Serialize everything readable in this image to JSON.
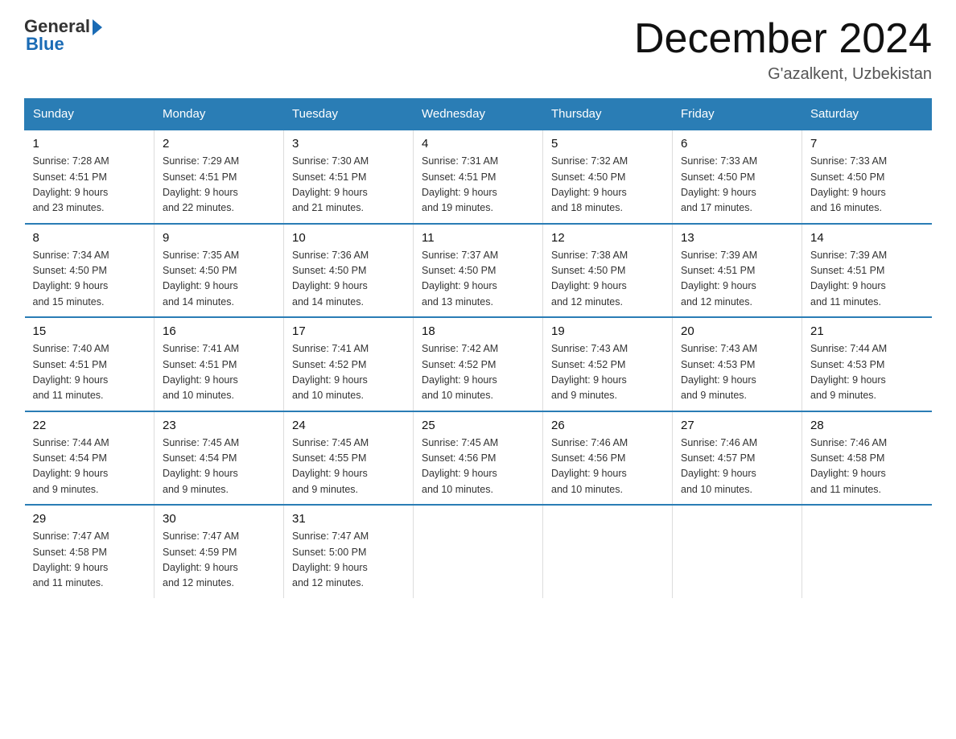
{
  "header": {
    "logo_general": "General",
    "logo_blue": "Blue",
    "title": "December 2024",
    "subtitle": "G'azalkent, Uzbekistan"
  },
  "days_of_week": [
    "Sunday",
    "Monday",
    "Tuesday",
    "Wednesday",
    "Thursday",
    "Friday",
    "Saturday"
  ],
  "weeks": [
    [
      {
        "day": "1",
        "sunrise": "7:28 AM",
        "sunset": "4:51 PM",
        "daylight": "9 hours and 23 minutes."
      },
      {
        "day": "2",
        "sunrise": "7:29 AM",
        "sunset": "4:51 PM",
        "daylight": "9 hours and 22 minutes."
      },
      {
        "day": "3",
        "sunrise": "7:30 AM",
        "sunset": "4:51 PM",
        "daylight": "9 hours and 21 minutes."
      },
      {
        "day": "4",
        "sunrise": "7:31 AM",
        "sunset": "4:51 PM",
        "daylight": "9 hours and 19 minutes."
      },
      {
        "day": "5",
        "sunrise": "7:32 AM",
        "sunset": "4:50 PM",
        "daylight": "9 hours and 18 minutes."
      },
      {
        "day": "6",
        "sunrise": "7:33 AM",
        "sunset": "4:50 PM",
        "daylight": "9 hours and 17 minutes."
      },
      {
        "day": "7",
        "sunrise": "7:33 AM",
        "sunset": "4:50 PM",
        "daylight": "9 hours and 16 minutes."
      }
    ],
    [
      {
        "day": "8",
        "sunrise": "7:34 AM",
        "sunset": "4:50 PM",
        "daylight": "9 hours and 15 minutes."
      },
      {
        "day": "9",
        "sunrise": "7:35 AM",
        "sunset": "4:50 PM",
        "daylight": "9 hours and 14 minutes."
      },
      {
        "day": "10",
        "sunrise": "7:36 AM",
        "sunset": "4:50 PM",
        "daylight": "9 hours and 14 minutes."
      },
      {
        "day": "11",
        "sunrise": "7:37 AM",
        "sunset": "4:50 PM",
        "daylight": "9 hours and 13 minutes."
      },
      {
        "day": "12",
        "sunrise": "7:38 AM",
        "sunset": "4:50 PM",
        "daylight": "9 hours and 12 minutes."
      },
      {
        "day": "13",
        "sunrise": "7:39 AM",
        "sunset": "4:51 PM",
        "daylight": "9 hours and 12 minutes."
      },
      {
        "day": "14",
        "sunrise": "7:39 AM",
        "sunset": "4:51 PM",
        "daylight": "9 hours and 11 minutes."
      }
    ],
    [
      {
        "day": "15",
        "sunrise": "7:40 AM",
        "sunset": "4:51 PM",
        "daylight": "9 hours and 11 minutes."
      },
      {
        "day": "16",
        "sunrise": "7:41 AM",
        "sunset": "4:51 PM",
        "daylight": "9 hours and 10 minutes."
      },
      {
        "day": "17",
        "sunrise": "7:41 AM",
        "sunset": "4:52 PM",
        "daylight": "9 hours and 10 minutes."
      },
      {
        "day": "18",
        "sunrise": "7:42 AM",
        "sunset": "4:52 PM",
        "daylight": "9 hours and 10 minutes."
      },
      {
        "day": "19",
        "sunrise": "7:43 AM",
        "sunset": "4:52 PM",
        "daylight": "9 hours and 9 minutes."
      },
      {
        "day": "20",
        "sunrise": "7:43 AM",
        "sunset": "4:53 PM",
        "daylight": "9 hours and 9 minutes."
      },
      {
        "day": "21",
        "sunrise": "7:44 AM",
        "sunset": "4:53 PM",
        "daylight": "9 hours and 9 minutes."
      }
    ],
    [
      {
        "day": "22",
        "sunrise": "7:44 AM",
        "sunset": "4:54 PM",
        "daylight": "9 hours and 9 minutes."
      },
      {
        "day": "23",
        "sunrise": "7:45 AM",
        "sunset": "4:54 PM",
        "daylight": "9 hours and 9 minutes."
      },
      {
        "day": "24",
        "sunrise": "7:45 AM",
        "sunset": "4:55 PM",
        "daylight": "9 hours and 9 minutes."
      },
      {
        "day": "25",
        "sunrise": "7:45 AM",
        "sunset": "4:56 PM",
        "daylight": "9 hours and 10 minutes."
      },
      {
        "day": "26",
        "sunrise": "7:46 AM",
        "sunset": "4:56 PM",
        "daylight": "9 hours and 10 minutes."
      },
      {
        "day": "27",
        "sunrise": "7:46 AM",
        "sunset": "4:57 PM",
        "daylight": "9 hours and 10 minutes."
      },
      {
        "day": "28",
        "sunrise": "7:46 AM",
        "sunset": "4:58 PM",
        "daylight": "9 hours and 11 minutes."
      }
    ],
    [
      {
        "day": "29",
        "sunrise": "7:47 AM",
        "sunset": "4:58 PM",
        "daylight": "9 hours and 11 minutes."
      },
      {
        "day": "30",
        "sunrise": "7:47 AM",
        "sunset": "4:59 PM",
        "daylight": "9 hours and 12 minutes."
      },
      {
        "day": "31",
        "sunrise": "7:47 AM",
        "sunset": "5:00 PM",
        "daylight": "9 hours and 12 minutes."
      },
      null,
      null,
      null,
      null
    ]
  ],
  "labels": {
    "sunrise": "Sunrise:",
    "sunset": "Sunset:",
    "daylight": "Daylight:"
  }
}
